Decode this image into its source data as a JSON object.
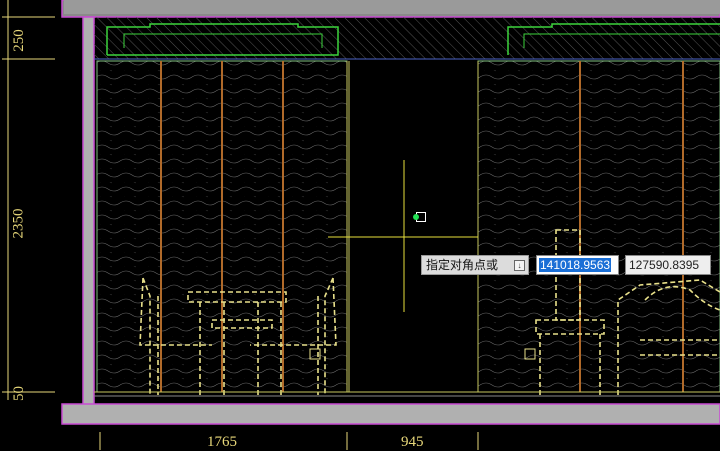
{
  "dimensions": {
    "left_vertical": [
      "250",
      "2350",
      "50"
    ],
    "bottom_horizontal": [
      "1765",
      "945"
    ]
  },
  "command_prompt": {
    "text": "指定对角点或",
    "option_icon": "options-arrow-icon"
  },
  "coordinates": {
    "x_value": "141018.9563",
    "y_value": "127590.8395"
  },
  "colors": {
    "background": "#000000",
    "wall_outline": "#c84bd2",
    "panel_line": "#c8c8c8",
    "wood_strip": "#b06a2a",
    "furniture": "#e8e08a",
    "ceiling": "#3cd43c",
    "crosshair": "#e8e03c",
    "selected_coord": "#1a6fd6"
  }
}
